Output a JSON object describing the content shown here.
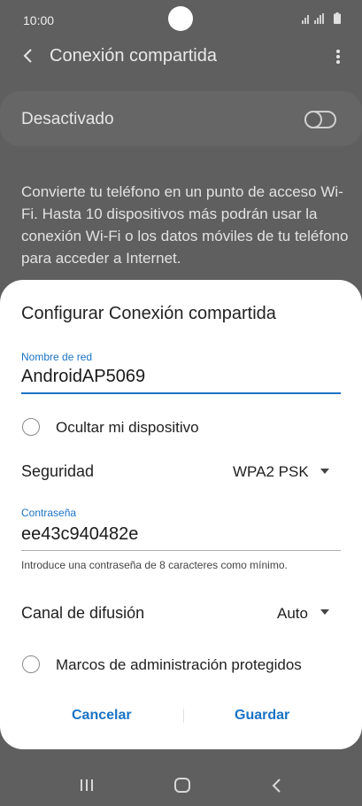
{
  "status": {
    "time": "10:00"
  },
  "header": {
    "title": "Conexión compartida"
  },
  "hotspot": {
    "state_label": "Desactivado",
    "enabled": false,
    "description": "Convierte tu teléfono en un punto de acceso Wi-Fi. Hasta 10 dispositivos más podrán usar la conexión Wi-Fi o los datos móviles de tu teléfono para acceder a Internet."
  },
  "dialog": {
    "title": "Configurar Conexión compartida",
    "network_name": {
      "label": "Nombre de red",
      "value": "AndroidAP5069"
    },
    "hide_device": {
      "label": "Ocultar mi dispositivo",
      "checked": false
    },
    "security": {
      "label": "Seguridad",
      "value": "WPA2 PSK"
    },
    "password": {
      "label": "Contraseña",
      "value": "ee43c940482e",
      "hint": "Introduce una contraseña de 8 caracteres como mínimo."
    },
    "channel": {
      "label": "Canal de difusión",
      "value": "Auto"
    },
    "pmf": {
      "label": "Marcos de administración protegidos",
      "checked": false
    },
    "cancel_label": "Cancelar",
    "save_label": "Guardar"
  },
  "colors": {
    "accent": "#1a73c4",
    "dim_background": "#5f5f5f",
    "dialog": "#ffffff"
  },
  "icons": [
    "signal-icon",
    "battery-icon",
    "back-arrow-icon",
    "more-options-icon",
    "recents-icon",
    "home-icon",
    "nav-back-icon"
  ]
}
